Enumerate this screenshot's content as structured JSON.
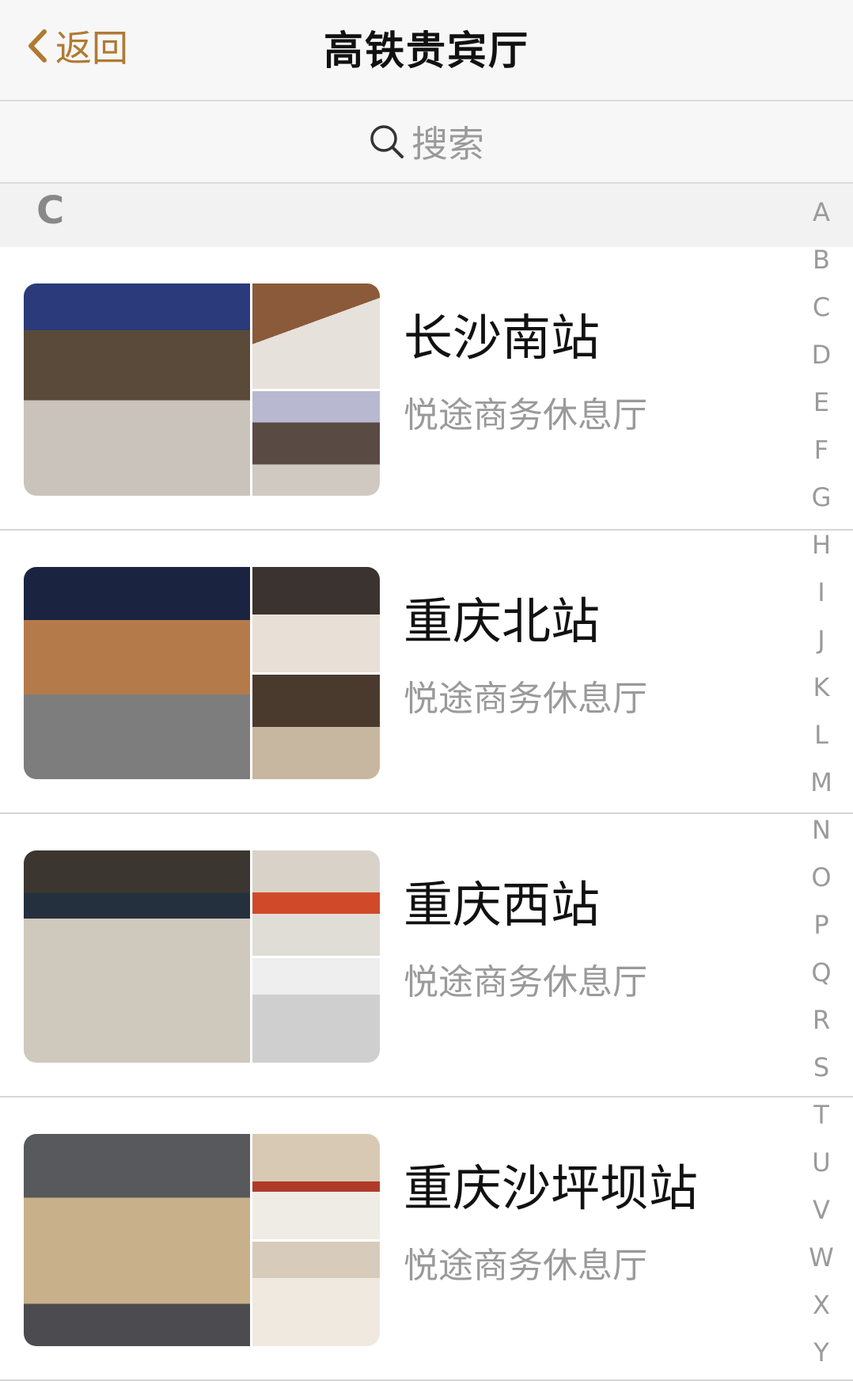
{
  "nav": {
    "back_label": "返回",
    "title": "高铁贵宾厅"
  },
  "search": {
    "placeholder": "搜索"
  },
  "section": {
    "letter": "C"
  },
  "stations": [
    {
      "name": "长沙南站",
      "lounge": "悦途商务休息厅"
    },
    {
      "name": "重庆北站",
      "lounge": "悦途商务休息厅"
    },
    {
      "name": "重庆西站",
      "lounge": "悦途商务休息厅"
    },
    {
      "name": "重庆沙坪坝站",
      "lounge": "悦途商务休息厅"
    }
  ],
  "index_letters": [
    "A",
    "B",
    "C",
    "D",
    "E",
    "F",
    "G",
    "H",
    "I",
    "J",
    "K",
    "L",
    "M",
    "N",
    "O",
    "P",
    "Q",
    "R",
    "S",
    "T",
    "U",
    "V",
    "W",
    "X",
    "Y"
  ],
  "colors": {
    "accent": "#b07a33",
    "nav_bg": "#f7f7f7",
    "section_bg": "#f2f2f2",
    "subtext": "#9a9a9a"
  }
}
